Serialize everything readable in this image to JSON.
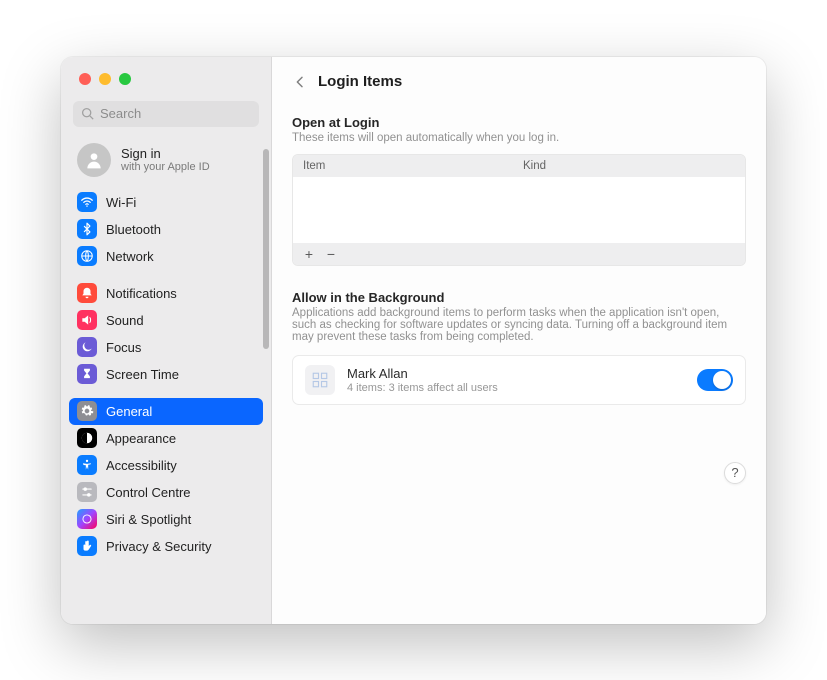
{
  "search": {
    "placeholder": "Search"
  },
  "signin": {
    "title": "Sign in",
    "subtitle": "with your Apple ID"
  },
  "sidebar": {
    "groups": [
      {
        "items": [
          {
            "id": "wifi",
            "label": "Wi-Fi",
            "color": "#0a7cff"
          },
          {
            "id": "bluetooth",
            "label": "Bluetooth",
            "color": "#0a7cff"
          },
          {
            "id": "network",
            "label": "Network",
            "color": "#0a7cff"
          }
        ]
      },
      {
        "items": [
          {
            "id": "notifications",
            "label": "Notifications",
            "color": "#ff4b3b"
          },
          {
            "id": "sound",
            "label": "Sound",
            "color": "#ff3161"
          },
          {
            "id": "focus",
            "label": "Focus",
            "color": "#6b5bd6"
          },
          {
            "id": "screen-time",
            "label": "Screen Time",
            "color": "#6b5bd6"
          }
        ]
      },
      {
        "items": [
          {
            "id": "general",
            "label": "General",
            "color": "#8e8e93",
            "selected": true
          },
          {
            "id": "appearance",
            "label": "Appearance",
            "color": "#000000"
          },
          {
            "id": "accessibility",
            "label": "Accessibility",
            "color": "#0a7cff"
          },
          {
            "id": "control-centre",
            "label": "Control Centre",
            "color": "#b9b9be"
          },
          {
            "id": "siri-spotlight",
            "label": "Siri & Spotlight",
            "color": "#222222"
          },
          {
            "id": "privacy-security",
            "label": "Privacy & Security",
            "color": "#0a7cff"
          }
        ]
      }
    ]
  },
  "header": {
    "title": "Login Items"
  },
  "open_at_login": {
    "heading": "Open at Login",
    "subheading": "These items will open automatically when you log in.",
    "columns": {
      "item": "Item",
      "kind": "Kind"
    },
    "buttons": {
      "add": "+",
      "remove": "−"
    }
  },
  "allow_bg": {
    "heading": "Allow in the Background",
    "subheading": "Applications add background items to perform tasks when the application isn't open, such as checking for software updates or syncing data. Turning off a background item may prevent these tasks from being completed.",
    "row": {
      "title": "Mark Allan",
      "subtitle": "4 items: 3 items affect all users",
      "enabled": true
    }
  },
  "help_label": "?"
}
